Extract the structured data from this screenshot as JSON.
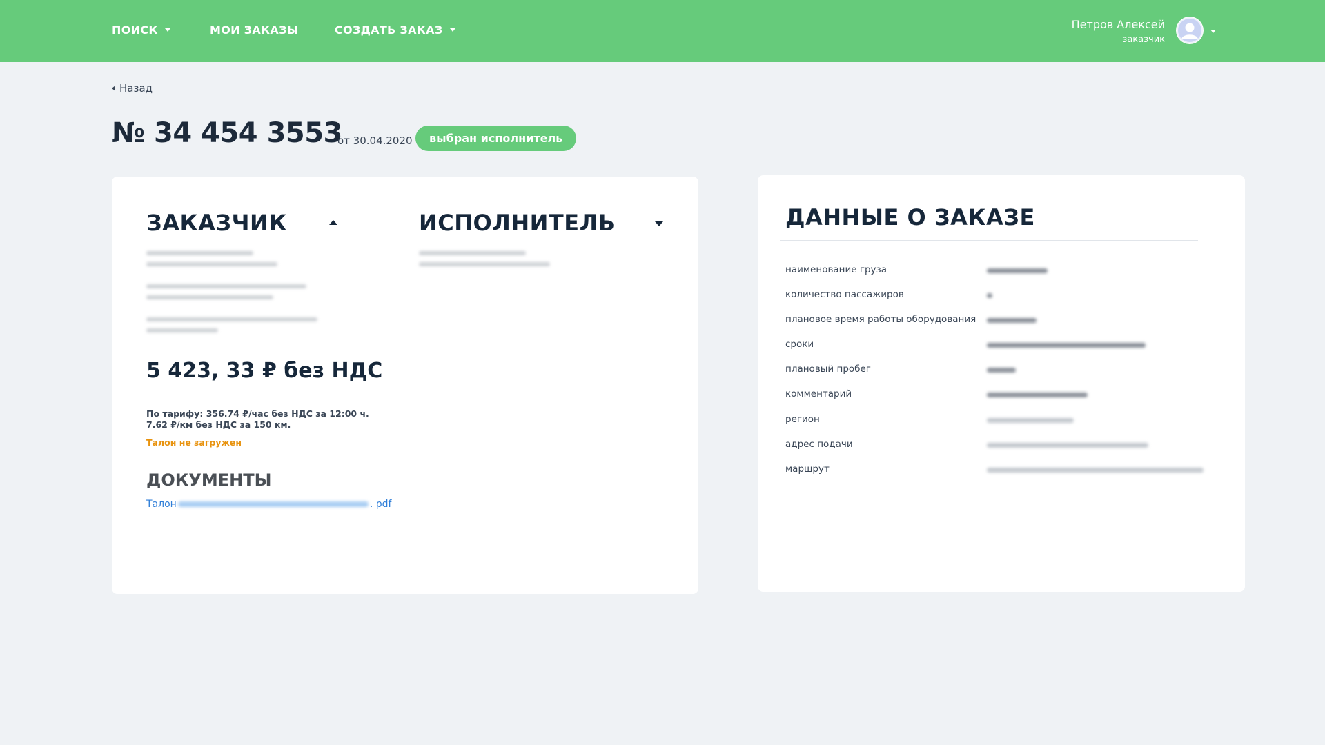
{
  "header": {
    "nav": [
      {
        "label": "ПОИСК",
        "dropdown": true
      },
      {
        "label": "МОИ ЗАКАЗЫ",
        "dropdown": false
      },
      {
        "label": "СОЗДАТЬ ЗАКАЗ",
        "dropdown": true
      }
    ],
    "user": {
      "name": "Петров Алексей",
      "role": "заказчик",
      "avatar_icon": "user-avatar-icon"
    },
    "colors": {
      "bar": "#66cb7b"
    }
  },
  "back_label": "Назад",
  "order": {
    "number": "№ 34 454 3553",
    "date": "от 30.04.2020",
    "status": "выбран исполнитель"
  },
  "parties": {
    "customer_title": "ЗАКАЗЧИК",
    "executor_title": "ИСПОЛНИТЕЛЬ"
  },
  "price": {
    "total": "5 423, 33 ₽ без НДС",
    "tariff_line1": "По тарифу: 356.74 ₽/час без НДС за 12:00 ч.",
    "tariff_line2": "7.62 ₽/км без НДС за 150 км.",
    "warning": "Талон не загружен",
    "warning_color": "#e8930f"
  },
  "documents": {
    "title": "ДОКУМЕНТЫ",
    "link_prefix": "Талон",
    "link_suffix": ". pdf"
  },
  "order_details": {
    "title": "ДАННЫЕ О ЗАКАЗЕ",
    "rows": [
      {
        "label": "наименование груза"
      },
      {
        "label": "количество пассажиров"
      },
      {
        "label": "плановое время работы оборудования"
      },
      {
        "label": "сроки"
      },
      {
        "label": "плановый пробег"
      },
      {
        "label": "комментарий"
      },
      {
        "label": "регион"
      },
      {
        "label": "адрес подачи"
      },
      {
        "label": "маршрут"
      }
    ]
  }
}
